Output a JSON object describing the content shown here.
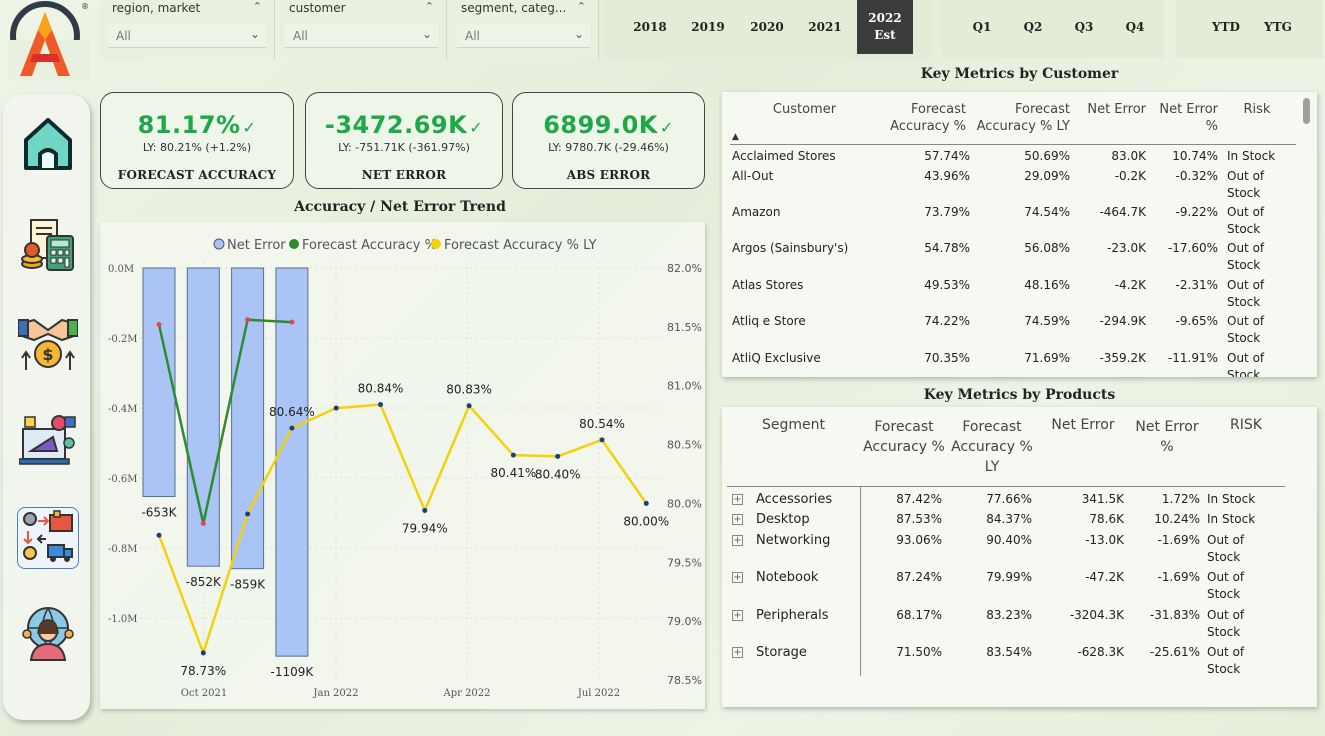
{
  "slicers": [
    {
      "title": "region, market",
      "value": "All"
    },
    {
      "title": "customer",
      "value": "All"
    },
    {
      "title": "segment, categ...",
      "value": "All"
    }
  ],
  "years": [
    "2018",
    "2019",
    "2020",
    "2021",
    "2022",
    "Est"
  ],
  "quarters": [
    "Q1",
    "Q2",
    "Q3",
    "Q4"
  ],
  "periods": [
    "YTD",
    "YTG"
  ],
  "nav_icons": [
    "home-icon",
    "finance-calculator-icon",
    "sales-handshake-icon",
    "marketing-icon",
    "supply-chain-icon",
    "executive-globe-icon"
  ],
  "kpis": {
    "forecast_accuracy": {
      "value": "81.17%",
      "sub": "LY: 80.21% (+1.2%)",
      "title": "FORECAST ACCURACY"
    },
    "net_error": {
      "value": "-3472.69K",
      "sub": "LY: -751.71K (-361.97%)",
      "title": "NET ERROR"
    },
    "abs_error": {
      "value": "6899.0K",
      "sub": "LY: 9780.7K (-29.46%)",
      "title": "ABS ERROR"
    }
  },
  "colors": {
    "accent_green": "#1fa84a",
    "bar_blue": "#a9c4f5",
    "line_green": "#2e8b2e",
    "line_yellow": "#f2d20a",
    "dark": "#3b3b3b"
  },
  "chart_data": {
    "type": "line",
    "title": "Accuracy / Net Error Trend",
    "legend": [
      "Net Error",
      "Forecast Accuracy %",
      "Forecast Accuracy % LY"
    ],
    "legend_position": "top",
    "x_ticks": [
      "Oct 2021",
      "Jan 2022",
      "Apr 2022",
      "Jul 2022"
    ],
    "y_left_ticks": [
      "0.0M",
      "-0.2M",
      "-0.4M",
      "-0.6M",
      "-0.8M",
      "-1.0M"
    ],
    "y_right_ticks": [
      "82.0%",
      "81.5%",
      "81.0%",
      "80.5%",
      "80.0%",
      "79.5%",
      "79.0%",
      "78.5%"
    ],
    "y_left_range": [
      -1.2,
      0.0
    ],
    "y_right_range": [
      78.5,
      82.0
    ],
    "x": [
      "2021-09",
      "2021-10",
      "2021-11",
      "2021-12",
      "2022-01",
      "2022-02",
      "2022-03",
      "2022-04",
      "2022-05",
      "2022-06",
      "2022-07",
      "2022-08"
    ],
    "series": [
      {
        "name": "Net Error",
        "kind": "bar",
        "values": [
          -653,
          -852,
          -859,
          -1109
        ],
        "labels": [
          "-653K",
          "-852K",
          "-859K",
          "-1109K"
        ]
      },
      {
        "name": "Forecast Accuracy %",
        "kind": "line",
        "values": [
          81.52,
          79.83,
          81.56,
          81.54
        ]
      },
      {
        "name": "Forecast Accuracy % LY",
        "kind": "line",
        "values": [
          79.73,
          78.73,
          79.91,
          80.64,
          80.81,
          80.84,
          79.94,
          80.83,
          80.41,
          80.4,
          80.54,
          80.0
        ],
        "labels": [
          "",
          "78.73%",
          "",
          "80.64%",
          "",
          "80.84%",
          "79.94%",
          "80.83%",
          "80.41%",
          "80.40%",
          "80.54%",
          "80.00%"
        ]
      }
    ]
  },
  "customer_table": {
    "title": "Key Metrics by Customer",
    "headers": [
      "Customer",
      "Forecast Accuracy %",
      "Forecast Accuracy % LY",
      "Net Error",
      "Net Error %",
      "Risk"
    ],
    "rows": [
      [
        "Acclaimed Stores",
        "57.74%",
        "50.69%",
        "83.0K",
        "10.74%",
        "In Stock"
      ],
      [
        "All-Out",
        "43.96%",
        "29.09%",
        "-0.2K",
        "-0.32%",
        "Out of Stock"
      ],
      [
        "Amazon",
        "73.79%",
        "74.54%",
        "-464.7K",
        "-9.22%",
        "Out of Stock"
      ],
      [
        "Argos (Sainsbury's)",
        "54.78%",
        "56.08%",
        "-23.0K",
        "-17.60%",
        "Out of Stock"
      ],
      [
        "Atlas Stores",
        "49.53%",
        "48.16%",
        "-4.2K",
        "-2.31%",
        "Out of Stock"
      ],
      [
        "Atliq e Store",
        "74.22%",
        "74.59%",
        "-294.9K",
        "-9.65%",
        "Out of Stock"
      ],
      [
        "AtliQ Exclusive",
        "70.35%",
        "71.69%",
        "-359.2K",
        "-11.91%",
        "Out of Stock"
      ]
    ]
  },
  "product_table": {
    "title": "Key Metrics by Products",
    "headers": [
      "Segment",
      "Forecast Accuracy %",
      "Forecast Accuracy % LY",
      "Net Error",
      "Net Error %",
      "RISK"
    ],
    "rows": [
      [
        "Accessories",
        "87.42%",
        "77.66%",
        "341.5K",
        "1.72%",
        "In Stock"
      ],
      [
        "Desktop",
        "87.53%",
        "84.37%",
        "78.6K",
        "10.24%",
        "In Stock"
      ],
      [
        "Networking",
        "93.06%",
        "90.40%",
        "-13.0K",
        "-1.69%",
        "Out of Stock"
      ],
      [
        "Notebook",
        "87.24%",
        "79.99%",
        "-47.2K",
        "-1.69%",
        "Out of Stock"
      ],
      [
        "Peripherals",
        "68.17%",
        "83.23%",
        "-3204.3K",
        "-31.83%",
        "Out of Stock"
      ],
      [
        "Storage",
        "71.50%",
        "83.54%",
        "-628.3K",
        "-25.61%",
        "Out of Stock"
      ]
    ]
  }
}
